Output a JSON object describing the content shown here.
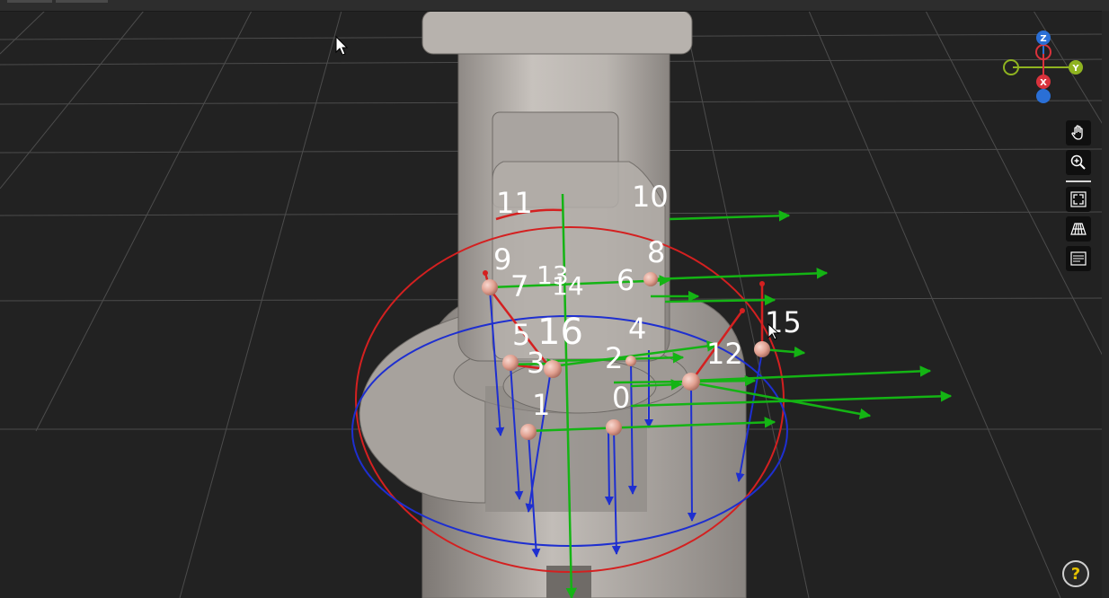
{
  "viewport": {
    "background": "#222222",
    "grid_color": "#5a5a5a"
  },
  "axis_gizmo": {
    "z_label": "Z",
    "x_label": "X",
    "y_label": "Y",
    "x_color": "#d9323c",
    "y_color": "#8fb320",
    "z_color": "#2a6fd6"
  },
  "toolbar": {
    "pan_icon": "hand-icon",
    "zoom_icon": "zoom-in-icon",
    "fit_icon": "fit-view-icon",
    "grid_icon": "grid-floor-icon",
    "list_icon": "list-panel-icon"
  },
  "help": {
    "label": "?"
  },
  "frame_labels": [
    {
      "id": "label-0",
      "text": "0"
    },
    {
      "id": "label-1",
      "text": "1"
    },
    {
      "id": "label-2",
      "text": "2"
    },
    {
      "id": "label-3",
      "text": "3"
    },
    {
      "id": "label-4",
      "text": "4"
    },
    {
      "id": "label-5",
      "text": "5"
    },
    {
      "id": "label-6",
      "text": "6"
    },
    {
      "id": "label-7",
      "text": "7"
    },
    {
      "id": "label-8",
      "text": "8"
    },
    {
      "id": "label-9",
      "text": "9"
    },
    {
      "id": "label-10",
      "text": "10"
    },
    {
      "id": "label-11",
      "text": "11"
    },
    {
      "id": "label-12",
      "text": "12"
    },
    {
      "id": "label-13",
      "text": "13"
    },
    {
      "id": "label-14",
      "text": "14"
    },
    {
      "id": "label-15",
      "text": "15"
    },
    {
      "id": "label-16",
      "text": "16"
    }
  ],
  "colors": {
    "x_axis_arrow": "#d42020",
    "y_axis_arrow": "#14b414",
    "z_axis_arrow": "#1e2fd0",
    "joint_sphere": "#e8a898",
    "robot_body": "#bdb8b3"
  }
}
